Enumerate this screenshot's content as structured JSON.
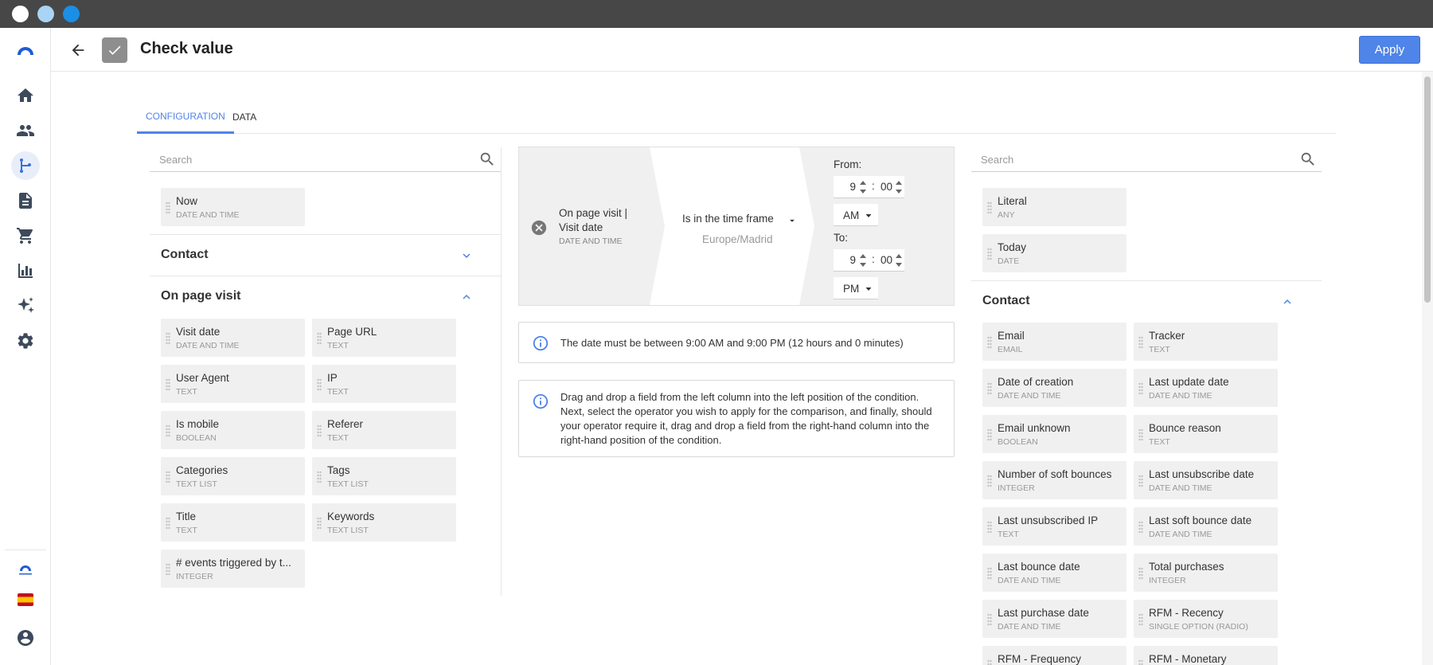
{
  "app": {
    "title": "Check value",
    "apply_label": "Apply"
  },
  "colors": {
    "accent": "#4f84e8",
    "titlebar": "#474747",
    "dot_white": "#ffffff",
    "dot_lightblue": "#a9d4f5",
    "dot_blue": "#1b8ee6"
  },
  "sidebar": {
    "items": [
      {
        "icon": "logo-icon"
      },
      {
        "icon": "home-icon"
      },
      {
        "icon": "contacts-icon"
      },
      {
        "icon": "workflow-icon",
        "active": true
      },
      {
        "icon": "document-icon"
      },
      {
        "icon": "cart-icon"
      },
      {
        "icon": "bar-chart-icon"
      },
      {
        "icon": "sparkle-icon"
      },
      {
        "icon": "gear-icon"
      },
      {
        "icon": "connectif-logo-icon"
      },
      {
        "icon": "spain-flag-icon"
      },
      {
        "icon": "account-icon"
      }
    ]
  },
  "tabs": [
    {
      "label": "CONFIGURATION",
      "active": true
    },
    {
      "label": "DATA",
      "active": false
    }
  ],
  "left": {
    "search_placeholder": "Search",
    "top_items": [
      {
        "name": "Now",
        "type": "DATE AND TIME"
      }
    ],
    "contact_title": "Contact",
    "onpage_title": "On page visit",
    "onpage_items": [
      {
        "name": "Visit date",
        "type": "DATE AND TIME"
      },
      {
        "name": "Page URL",
        "type": "TEXT"
      },
      {
        "name": "User Agent",
        "type": "TEXT"
      },
      {
        "name": "IP",
        "type": "TEXT"
      },
      {
        "name": "Is mobile",
        "type": "BOOLEAN"
      },
      {
        "name": "Referer",
        "type": "TEXT"
      },
      {
        "name": "Categories",
        "type": "TEXT LIST"
      },
      {
        "name": "Tags",
        "type": "TEXT LIST"
      },
      {
        "name": "Title",
        "type": "TEXT"
      },
      {
        "name": "Keywords",
        "type": "TEXT LIST"
      },
      {
        "name": "# events triggered by t...",
        "type": "INTEGER"
      }
    ]
  },
  "condition": {
    "field_line1": "On page visit |",
    "field_line2": "Visit date",
    "field_type": "DATE AND TIME",
    "operator": "Is in the time frame",
    "timezone": "Europe/Madrid",
    "from_label": "From:",
    "from_hour": "9",
    "from_minute": "00",
    "from_ampm": "AM",
    "to_label": "To:",
    "to_hour": "9",
    "to_minute": "00",
    "to_ampm": "PM",
    "time_separator": ":"
  },
  "info": {
    "range_text": "The date must be between 9:00 AM and 9:00 PM (12 hours and 0 minutes)",
    "help_text": "Drag and drop a field from the left column into the left position of the condition. Next, select the operator you wish to apply for the comparison, and finally, should your operator require it, drag and drop a field from the right-hand column into the right-hand position of the condition."
  },
  "right": {
    "search_placeholder": "Search",
    "top_items": [
      {
        "name": "Literal",
        "type": "ANY"
      },
      {
        "name": "Today",
        "type": "DATE"
      }
    ],
    "contact_title": "Contact",
    "contact_items": [
      {
        "name": "Email",
        "type": "EMAIL"
      },
      {
        "name": "Tracker",
        "type": "TEXT"
      },
      {
        "name": "Date of creation",
        "type": "DATE AND TIME"
      },
      {
        "name": "Last update date",
        "type": "DATE AND TIME"
      },
      {
        "name": "Email unknown",
        "type": "BOOLEAN"
      },
      {
        "name": "Bounce reason",
        "type": "TEXT"
      },
      {
        "name": "Number of soft bounces",
        "type": "INTEGER"
      },
      {
        "name": "Last unsubscribe date",
        "type": "DATE AND TIME"
      },
      {
        "name": "Last unsubscribed IP",
        "type": "TEXT"
      },
      {
        "name": "Last soft bounce date",
        "type": "DATE AND TIME"
      },
      {
        "name": "Last bounce date",
        "type": "DATE AND TIME"
      },
      {
        "name": "Total purchases",
        "type": "INTEGER"
      },
      {
        "name": "Last purchase date",
        "type": "DATE AND TIME"
      },
      {
        "name": "RFM - Recency",
        "type": "SINGLE OPTION (RADIO)"
      },
      {
        "name": "RFM - Frequency",
        "type": ""
      },
      {
        "name": "RFM - Monetary",
        "type": ""
      }
    ]
  }
}
